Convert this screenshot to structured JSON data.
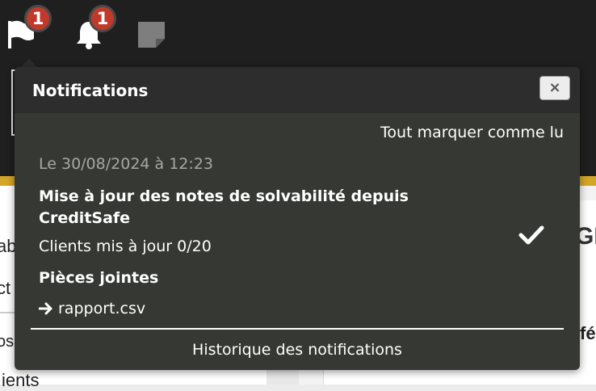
{
  "topbar": {
    "icons": [
      "flag-icon",
      "bell-icon",
      "sticky-note-icon"
    ],
    "flag_badge": "1",
    "bell_badge": "1"
  },
  "background": {
    "left_texts": [
      "ab",
      "ct",
      "os",
      "ients"
    ],
    "right_heading": "GE",
    "right_text": "fé",
    "accent_color": "#d4a627"
  },
  "notifications": {
    "title": "Notifications",
    "close_label": "×",
    "mark_all_read": "Tout marquer comme lu",
    "item": {
      "date": "Le 30/08/2024 à 12:23",
      "title": "Mise à jour des notes de solvabilité depuis CreditSafe",
      "body": "Clients mis à jour 0/20",
      "attachments_label": "Pièces jointes",
      "attachment": "rapport.csv",
      "read_icon": "check-icon"
    },
    "history_link": "Historique des notifications"
  }
}
